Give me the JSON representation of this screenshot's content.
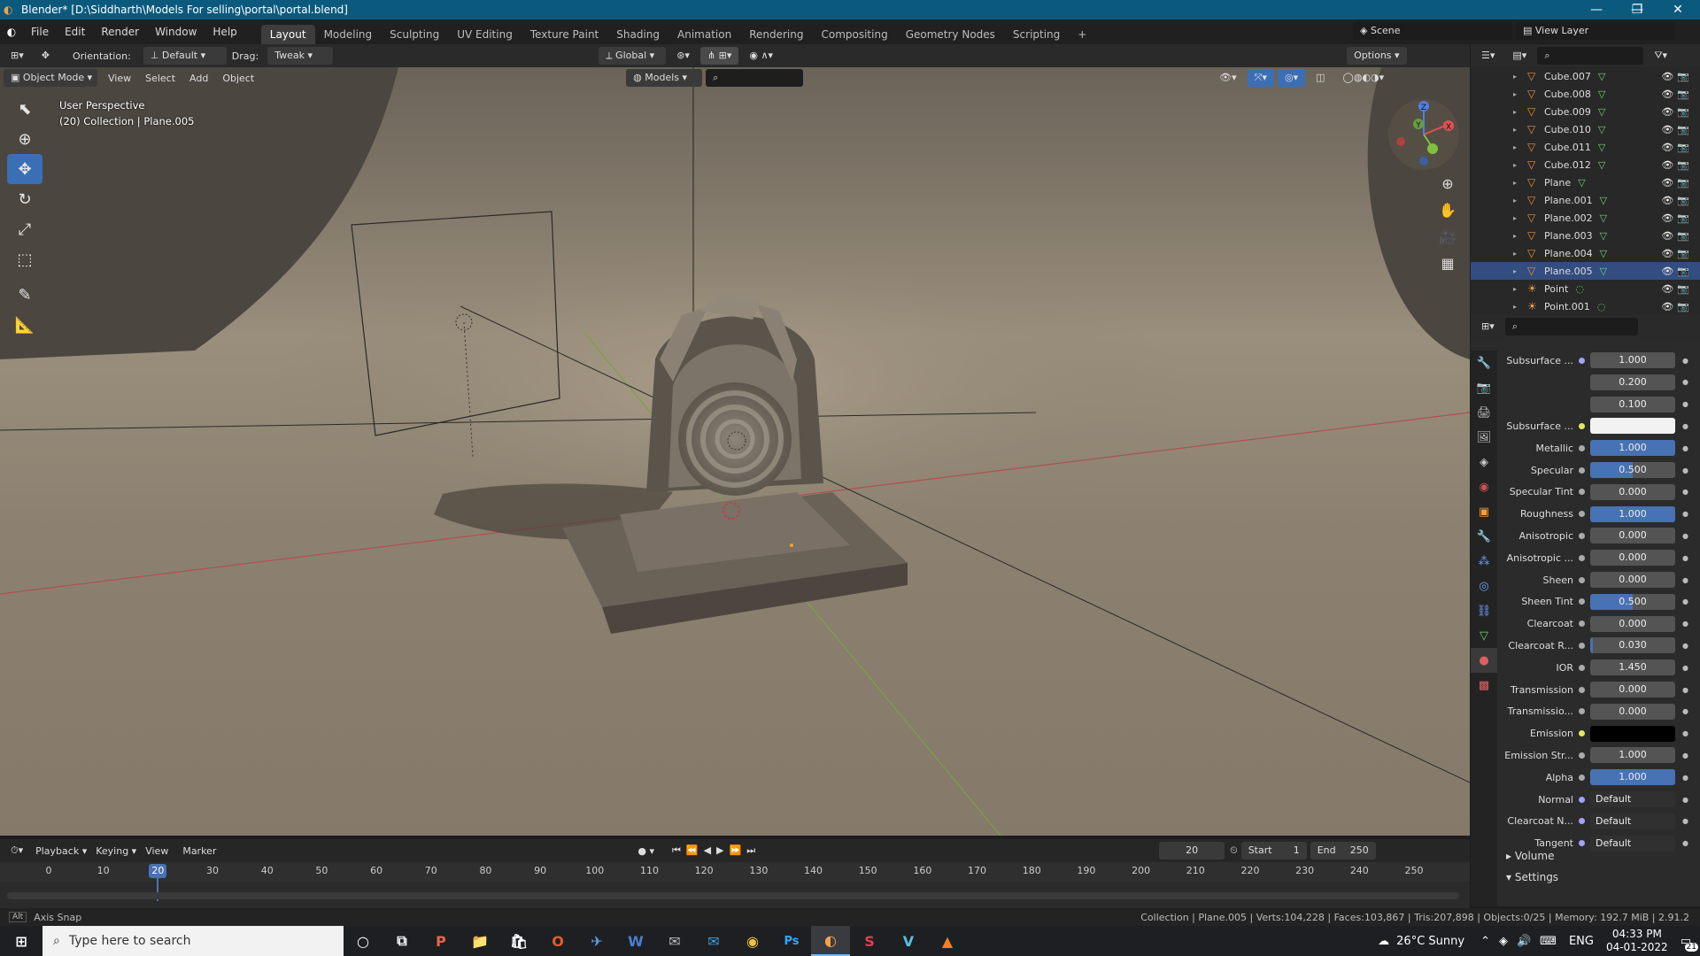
{
  "window": {
    "title": "Blender* [D:\\Siddharth\\Models For selling\\portal\\portal.blend]"
  },
  "menu": [
    "File",
    "Edit",
    "Render",
    "Window",
    "Help"
  ],
  "workspaces": [
    "Layout",
    "Modeling",
    "Sculpting",
    "UV Editing",
    "Texture Paint",
    "Shading",
    "Animation",
    "Rendering",
    "Compositing",
    "Geometry Nodes",
    "Scripting"
  ],
  "active_workspace": "Layout",
  "scene": {
    "name": "Scene",
    "view_layer": "View Layer"
  },
  "viewport_header": {
    "orientation_label": "Orientation:",
    "orientation_value": "Default",
    "drag_label": "Drag:",
    "drag_value": "Tweak",
    "transform_orientation": "Global",
    "options": "Options",
    "mode": "Object Mode",
    "menus": [
      "View",
      "Select",
      "Add",
      "Object"
    ],
    "models_filter": "Models"
  },
  "viewport_info": {
    "line1": "User Perspective",
    "line2": "(20) Collection | Plane.005"
  },
  "gizmo": {
    "x": "X",
    "y": "Y",
    "z": "Z"
  },
  "outliner": [
    {
      "name": "Cube.007",
      "type": "mesh",
      "selected": false
    },
    {
      "name": "Cube.008",
      "type": "mesh",
      "selected": false
    },
    {
      "name": "Cube.009",
      "type": "mesh",
      "selected": false
    },
    {
      "name": "Cube.010",
      "type": "mesh",
      "selected": false
    },
    {
      "name": "Cube.011",
      "type": "mesh",
      "selected": false
    },
    {
      "name": "Cube.012",
      "type": "mesh",
      "selected": false
    },
    {
      "name": "Plane",
      "type": "mesh",
      "selected": false
    },
    {
      "name": "Plane.001",
      "type": "mesh",
      "selected": false
    },
    {
      "name": "Plane.002",
      "type": "mesh",
      "selected": false
    },
    {
      "name": "Plane.003",
      "type": "mesh",
      "selected": false
    },
    {
      "name": "Plane.004",
      "type": "mesh",
      "selected": false
    },
    {
      "name": "Plane.005",
      "type": "mesh",
      "selected": true
    },
    {
      "name": "Point",
      "type": "light",
      "selected": false
    },
    {
      "name": "Point.001",
      "type": "light",
      "selected": false
    }
  ],
  "properties": [
    {
      "label": "Subsurface ...",
      "value": "1.000",
      "kind": "num",
      "dot": "purple",
      "fill": 0
    },
    {
      "label": "",
      "value": "0.200",
      "kind": "num",
      "dot": "",
      "fill": 0
    },
    {
      "label": "",
      "value": "0.100",
      "kind": "num",
      "dot": "",
      "fill": 0
    },
    {
      "label": "Subsurface ...",
      "value": "",
      "kind": "white",
      "dot": "yellow",
      "fill": 0
    },
    {
      "label": "Metallic",
      "value": "1.000",
      "kind": "num",
      "dot": "grey",
      "fill": 1
    },
    {
      "label": "Specular",
      "value": "0.500",
      "kind": "num",
      "dot": "grey",
      "fill": 0.5
    },
    {
      "label": "Specular Tint",
      "value": "0.000",
      "kind": "num",
      "dot": "grey",
      "fill": 0
    },
    {
      "label": "Roughness",
      "value": "1.000",
      "kind": "num",
      "dot": "grey",
      "fill": 1
    },
    {
      "label": "Anisotropic",
      "value": "0.000",
      "kind": "num",
      "dot": "grey",
      "fill": 0
    },
    {
      "label": "Anisotropic ...",
      "value": "0.000",
      "kind": "num",
      "dot": "grey",
      "fill": 0
    },
    {
      "label": "Sheen",
      "value": "0.000",
      "kind": "num",
      "dot": "grey",
      "fill": 0
    },
    {
      "label": "Sheen Tint",
      "value": "0.500",
      "kind": "num",
      "dot": "grey",
      "fill": 0.5
    },
    {
      "label": "Clearcoat",
      "value": "0.000",
      "kind": "num",
      "dot": "grey",
      "fill": 0
    },
    {
      "label": "Clearcoat R...",
      "value": "0.030",
      "kind": "num",
      "dot": "grey",
      "fill": 0.03
    },
    {
      "label": "IOR",
      "value": "1.450",
      "kind": "num",
      "dot": "grey",
      "fill": 0
    },
    {
      "label": "Transmission",
      "value": "0.000",
      "kind": "num",
      "dot": "grey",
      "fill": 0
    },
    {
      "label": "Transmissio...",
      "value": "0.000",
      "kind": "num",
      "dot": "grey",
      "fill": 0
    },
    {
      "label": "Emission",
      "value": "",
      "kind": "black",
      "dot": "yellow",
      "fill": 0
    },
    {
      "label": "Emission Str...",
      "value": "1.000",
      "kind": "num",
      "dot": "grey",
      "fill": 0
    },
    {
      "label": "Alpha",
      "value": "1.000",
      "kind": "num",
      "dot": "grey",
      "fill": 1
    },
    {
      "label": "Normal",
      "value": "Default",
      "kind": "text",
      "dot": "purple",
      "fill": 0
    },
    {
      "label": "Clearcoat N...",
      "value": "Default",
      "kind": "text",
      "dot": "purple",
      "fill": 0
    },
    {
      "label": "Tangent",
      "value": "Default",
      "kind": "text",
      "dot": "purple",
      "fill": 0
    }
  ],
  "panels": {
    "volume": "Volume",
    "settings": "Settings"
  },
  "timeline": {
    "menus": [
      "Playback",
      "Keying",
      "View",
      "Marker"
    ],
    "current_frame": "20",
    "start_label": "Start",
    "start": "1",
    "end_label": "End",
    "end": "250",
    "ticks": [
      0,
      10,
      20,
      30,
      40,
      50,
      60,
      70,
      80,
      90,
      100,
      110,
      120,
      130,
      140,
      150,
      160,
      170,
      180,
      190,
      200,
      210,
      220,
      230,
      240,
      250
    ]
  },
  "statusbar": {
    "left": "Axis Snap",
    "right": "Collection | Plane.005 | Verts:104,228 | Faces:103,867 | Tris:207,898 | Objects:0/25 | Memory: 192.7 MiB | 2.91.2"
  },
  "taskbar": {
    "search_placeholder": "Type here to search",
    "apps": [
      "P",
      "📁",
      "🛍",
      "O",
      "✈",
      "W",
      "✉",
      "✉",
      "◉",
      "Ps",
      "◐",
      "S",
      "V",
      "▲"
    ],
    "weather": "26°C  Sunny",
    "lang": "ENG",
    "time": "04:33 PM",
    "date": "04-01-2022",
    "notifications": "21"
  }
}
